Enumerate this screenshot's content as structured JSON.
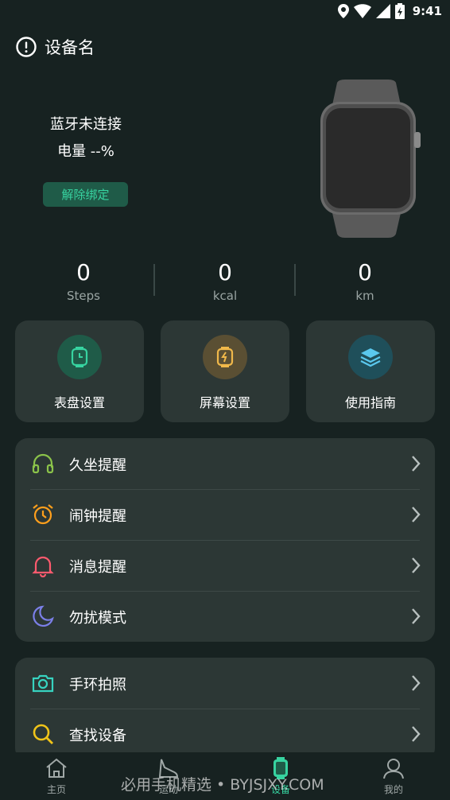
{
  "status_bar": {
    "time": "9:41",
    "icons": [
      "location-icon",
      "wifi-icon",
      "signal-icon",
      "battery-charging-icon"
    ]
  },
  "header": {
    "title": "设备名",
    "icon": "info-icon"
  },
  "device": {
    "connection_status": "蓝牙未连接",
    "battery": "电量 --%",
    "unbind_label": "解除绑定"
  },
  "stats": [
    {
      "value": "0",
      "unit": "Steps"
    },
    {
      "value": "0",
      "unit": "kcal"
    },
    {
      "value": "0",
      "unit": "km"
    }
  ],
  "cards": [
    {
      "label": "表盘设置",
      "icon": "watch-face-icon",
      "color": "#37d3a0"
    },
    {
      "label": "屏幕设置",
      "icon": "screen-icon",
      "color": "#f0b84a"
    },
    {
      "label": "使用指南",
      "icon": "layers-icon",
      "color": "#5ac8ee"
    }
  ],
  "reminders": [
    {
      "label": "久坐提醒",
      "icon": "headphones-icon",
      "color": "#8bc34a"
    },
    {
      "label": "闹钟提醒",
      "icon": "alarm-clock-icon",
      "color": "#ff9f1c"
    },
    {
      "label": "消息提醒",
      "icon": "bell-icon",
      "color": "#ff5a6e"
    },
    {
      "label": "勿扰模式",
      "icon": "moon-icon",
      "color": "#7b7fe8"
    }
  ],
  "tools": [
    {
      "label": "手环拍照",
      "icon": "camera-icon",
      "color": "#37d3c0"
    },
    {
      "label": "查找设备",
      "icon": "search-icon",
      "color": "#f0c419"
    }
  ],
  "nav": [
    {
      "label": "主页",
      "icon": "home-icon",
      "active": false
    },
    {
      "label": "运动",
      "icon": "shoe-icon",
      "active": false
    },
    {
      "label": "设备",
      "icon": "watch-icon",
      "active": true
    },
    {
      "label": "我的",
      "icon": "user-icon",
      "active": false
    }
  ],
  "watermark": "必用手机精选 • BYJSJXY.COM",
  "colors": {
    "background": "#172221",
    "card": "#2c3735",
    "accent": "#37d3a0"
  }
}
